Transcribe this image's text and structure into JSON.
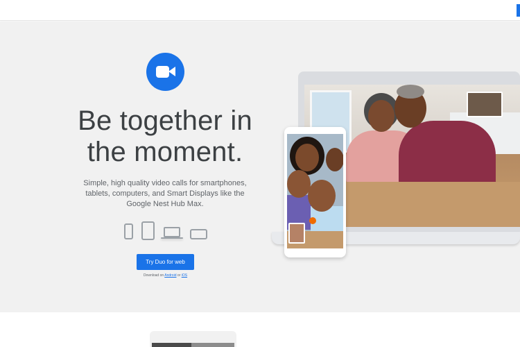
{
  "hero": {
    "headline_line1": "Be together in",
    "headline_line2": "the moment.",
    "description": "Simple, high quality video calls for smartphones, tablets, computers, and Smart Displays like the Google Nest Hub Max.",
    "cta_label": "Try Duo for web",
    "download_prefix": "Download on",
    "download_android": "Android",
    "download_or": "or",
    "download_ios": "iOS"
  },
  "devices": [
    "phone-icon",
    "tablet-icon",
    "laptop-icon",
    "smart-display-icon"
  ],
  "colors": {
    "accent": "#1a73e8",
    "hero_bg": "#f1f1f1",
    "headline": "#3c4043",
    "body_text": "#5f6368"
  },
  "icons": {
    "logo": "duo-camera-logo-icon"
  }
}
